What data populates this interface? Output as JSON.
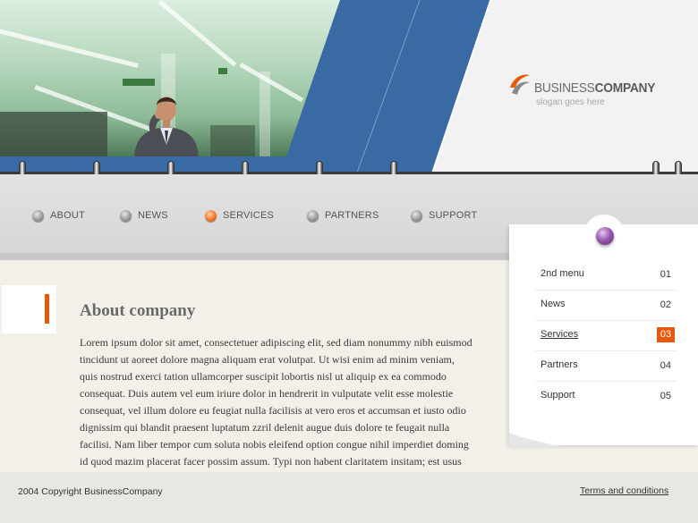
{
  "brand": {
    "name_part1": "BUSINESS",
    "name_part2": "COMPANY",
    "slogan": "slogan goes here"
  },
  "nav": {
    "items": [
      {
        "label": "ABOUT",
        "active": false
      },
      {
        "label": "NEWS",
        "active": false
      },
      {
        "label": "SERVICES",
        "active": true
      },
      {
        "label": "PARTNERS",
        "active": false
      },
      {
        "label": "SUPPORT",
        "active": false
      }
    ]
  },
  "content": {
    "title": "About company",
    "body": "Lorem ipsum dolor sit amet, consectetuer adipiscing elit, sed diam nonummy nibh euismod tincidunt ut aoreet dolore magna aliquam erat volutpat. Ut wisi enim ad minim veniam, quis nostrud exerci tation ullamcorper suscipit lobortis nisl ut aliquip ex ea commodo consequat. Duis autem vel eum iriure dolor in hendrerit in vulputate velit esse molestie consequat, vel illum dolore eu feugiat nulla facilisis at vero eros et accumsan et iusto odio dignissim qui blandit praesent luptatum zzril delenit augue duis dolore te feugait nulla facilisi. Nam liber tempor cum soluta nobis eleifend option congue nihil imperdiet doming id quod mazim placerat facer possim assum. Typi non habent claritatem insitam; est usus legentis in iis"
  },
  "side_menu": {
    "items": [
      {
        "label": "2nd menu",
        "number": "01",
        "active": false
      },
      {
        "label": "News",
        "number": "02",
        "active": false
      },
      {
        "label": "Services",
        "number": "03",
        "active": true
      },
      {
        "label": "Partners",
        "number": "04",
        "active": false
      },
      {
        "label": "Support",
        "number": "05",
        "active": false
      }
    ]
  },
  "footer": {
    "copyright": "2004 Copyright BusinessCompany",
    "terms": "Terms and conditions"
  },
  "colors": {
    "accent": "#e8590c",
    "header_blue": "#3a6aa3",
    "pin_purple": "#9a5bb0"
  }
}
